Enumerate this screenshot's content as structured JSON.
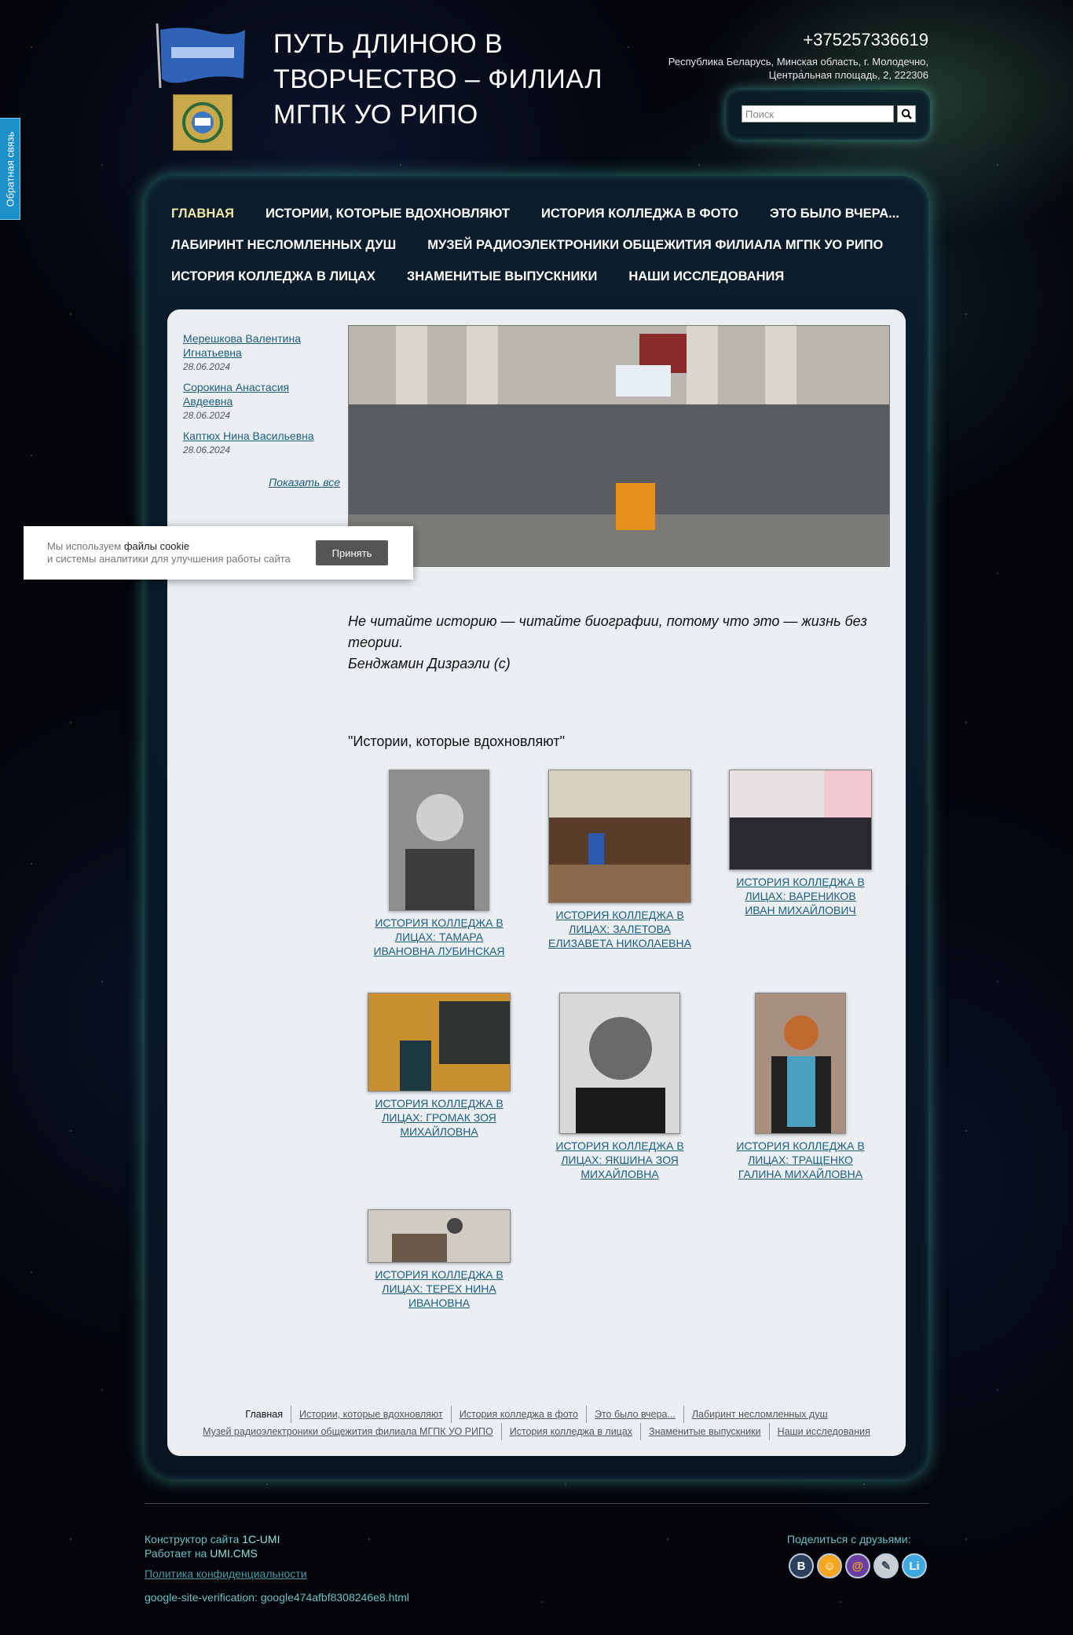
{
  "feedback_tab": "Обратная связь",
  "header": {
    "title": "ПУТЬ ДЛИНОЮ В ТВОРЧЕСТВО – ФИЛИАЛ МГПК УО РИПО",
    "phone": "+375257336619",
    "address": "Республика Беларусь, Минская область, г. Молодечно, Центральная площадь, 2, 222306",
    "search_placeholder": "Поиск"
  },
  "nav": {
    "rows": [
      [
        "ГЛАВНАЯ",
        "ИСТОРИИ, КОТОРЫЕ ВДОХНОВЛЯЮТ",
        "ИСТОРИЯ КОЛЛЕДЖА В ФОТО",
        "ЭТО БЫЛО ВЧЕРА..."
      ],
      [
        "ЛАБИРИНТ НЕСЛОМЛЕННЫХ ДУШ",
        "МУЗЕЙ РАДИОЭЛЕКТРОНИКИ ОБЩЕЖИТИЯ ФИЛИАЛА МГПК УО РИПО"
      ],
      [
        "ИСТОРИЯ КОЛЛЕДЖА В ЛИЦАХ",
        "ЗНАМЕНИТЫЕ ВЫПУСКНИКИ",
        "НАШИ ИССЛЕДОВАНИЯ"
      ]
    ]
  },
  "news": {
    "items": [
      {
        "name": "Мерешкова Валентина Игнатьевна",
        "date": "28.06.2024"
      },
      {
        "name": "Сорокина Анастасия Авдеевна",
        "date": "28.06.2024"
      },
      {
        "name": "Каптюх Нина Васильевна",
        "date": "28.06.2024"
      }
    ],
    "show_all": "Показать все"
  },
  "quote": {
    "text": "Не читайте историю — читайте биографии, потому что это — жизнь без теории.",
    "author": "Бенджамин Дизраэли (с)"
  },
  "section_title": "\"Истории, которые вдохновляют\"",
  "gallery": [
    {
      "caption": "ИСТОРИЯ КОЛЛЕДЖА В ЛИЦАХ: ТАМАРА ИВАНОВНА ЛУБИНСКАЯ"
    },
    {
      "caption": "ИСТОРИЯ КОЛЛЕДЖА В ЛИЦАХ: ЗАЛЕТОВА ЕЛИЗАВЕТА НИКОЛАЕВНА"
    },
    {
      "caption": "ИСТОРИЯ КОЛЛЕДЖА В ЛИЦАХ: ВАРЕНИКОВ ИВАН МИХАЙЛОВИЧ"
    },
    {
      "caption": "ИСТОРИЯ КОЛЛЕДЖА В ЛИЦАХ: ГРОМАК ЗОЯ МИХАЙЛОВНА"
    },
    {
      "caption": "ИСТОРИЯ КОЛЛЕДЖА В ЛИЦАХ: ЯКШИНА ЗОЯ МИХАЙЛОВНА"
    },
    {
      "caption": "ИСТОРИЯ КОЛЛЕДЖА В ЛИЦАХ: ТРАЩЕНКО ГАЛИНА МИХАЙЛОВНА"
    },
    {
      "caption": "ИСТОРИЯ КОЛЛЕДЖА В ЛИЦАХ: ТЕРЕХ НИНА ИВАНОВНА"
    }
  ],
  "footer_nav": {
    "row1": [
      "Главная",
      "Истории, которые вдохновляют",
      "История колледжа в фото",
      "Это было вчера...",
      "Лабиринт несломленных душ"
    ],
    "row2": [
      "Музей радиоэлектроники общежития филиала МГПК УО РИПО",
      "История колледжа в лицах",
      "Знаменитые выпускники",
      "Наши исследования"
    ]
  },
  "cookie": {
    "line1_prefix": "Мы используем ",
    "line1_bold": "файлы cookie",
    "line2": "и системы аналитики для улучшения работы сайта",
    "accept": "Принять"
  },
  "site_footer": {
    "constructor_prefix": "Конструктор сайта ",
    "constructor_name": "1C-UMI",
    "powered_prefix": "Работает на ",
    "powered_name": "UMI.CMS",
    "privacy": "Политика конфиденциальности",
    "verification": "google-site-verification: google474afbf8308246e8.html",
    "share_label": "Поделиться с друзьями:",
    "share_icons": [
      {
        "label": "В",
        "icon": "vk-icon",
        "color": "#2b3f5a"
      },
      {
        "label": "☺",
        "icon": "odnoklassniki-icon",
        "color": "#f5a623"
      },
      {
        "label": "@",
        "icon": "mailru-icon",
        "color": "#6b3fa0"
      },
      {
        "label": "✎",
        "icon": "livejournal-icon",
        "color": "#c8cfd4"
      },
      {
        "label": "Li",
        "icon": "liveinternet-icon",
        "color": "#3ea8e0"
      }
    ]
  }
}
